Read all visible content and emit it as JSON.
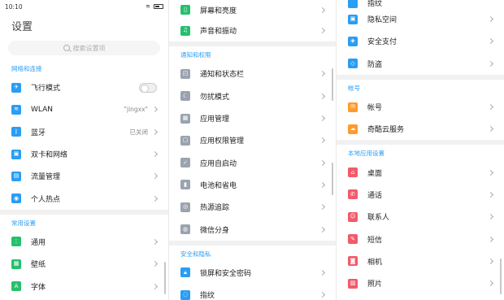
{
  "status": {
    "time": "10:10"
  },
  "header": {
    "title": "设置",
    "search_placeholder": "搜索设置项"
  },
  "panel1": {
    "net_section": "网络和连接",
    "airplane": "飞行模式",
    "wlan": "WLAN",
    "wlan_value": "\"jingxx\"",
    "bluetooth": "蓝牙",
    "bluetooth_value": "已关闭",
    "dual_sim": "双卡和网络",
    "traffic": "流量管理",
    "hotspot": "个人热点",
    "common_section": "常用设置",
    "general": "通用",
    "wallpaper": "壁纸",
    "font": "字体"
  },
  "panel2": {
    "display": "屏幕和亮度",
    "sound": "声音和振动",
    "notif_section": "通知和权限",
    "notif_status": "通知和状态栏",
    "dnd": "勿扰模式",
    "app_mgmt": "应用管理",
    "app_perm": "应用权限管理",
    "autostart": "应用自启动",
    "battery": "电池和省电",
    "heat": "热源追踪",
    "wechat": "微信分身",
    "security_section": "安全和隐私",
    "lock": "锁屏和安全密码",
    "fingerprint": "指纹"
  },
  "panel3": {
    "partial_top": "指纹",
    "privacy": "隐私空间",
    "payment": "安全支付",
    "antitheft": "防盗",
    "account_section": "帐号",
    "account": "帐号",
    "cloud": "奇酷云服务",
    "local_section": "本地应用设置",
    "desktop": "桌面",
    "call": "通话",
    "contacts": "联系人",
    "sms": "短信",
    "camera": "相机",
    "photos": "照片"
  }
}
